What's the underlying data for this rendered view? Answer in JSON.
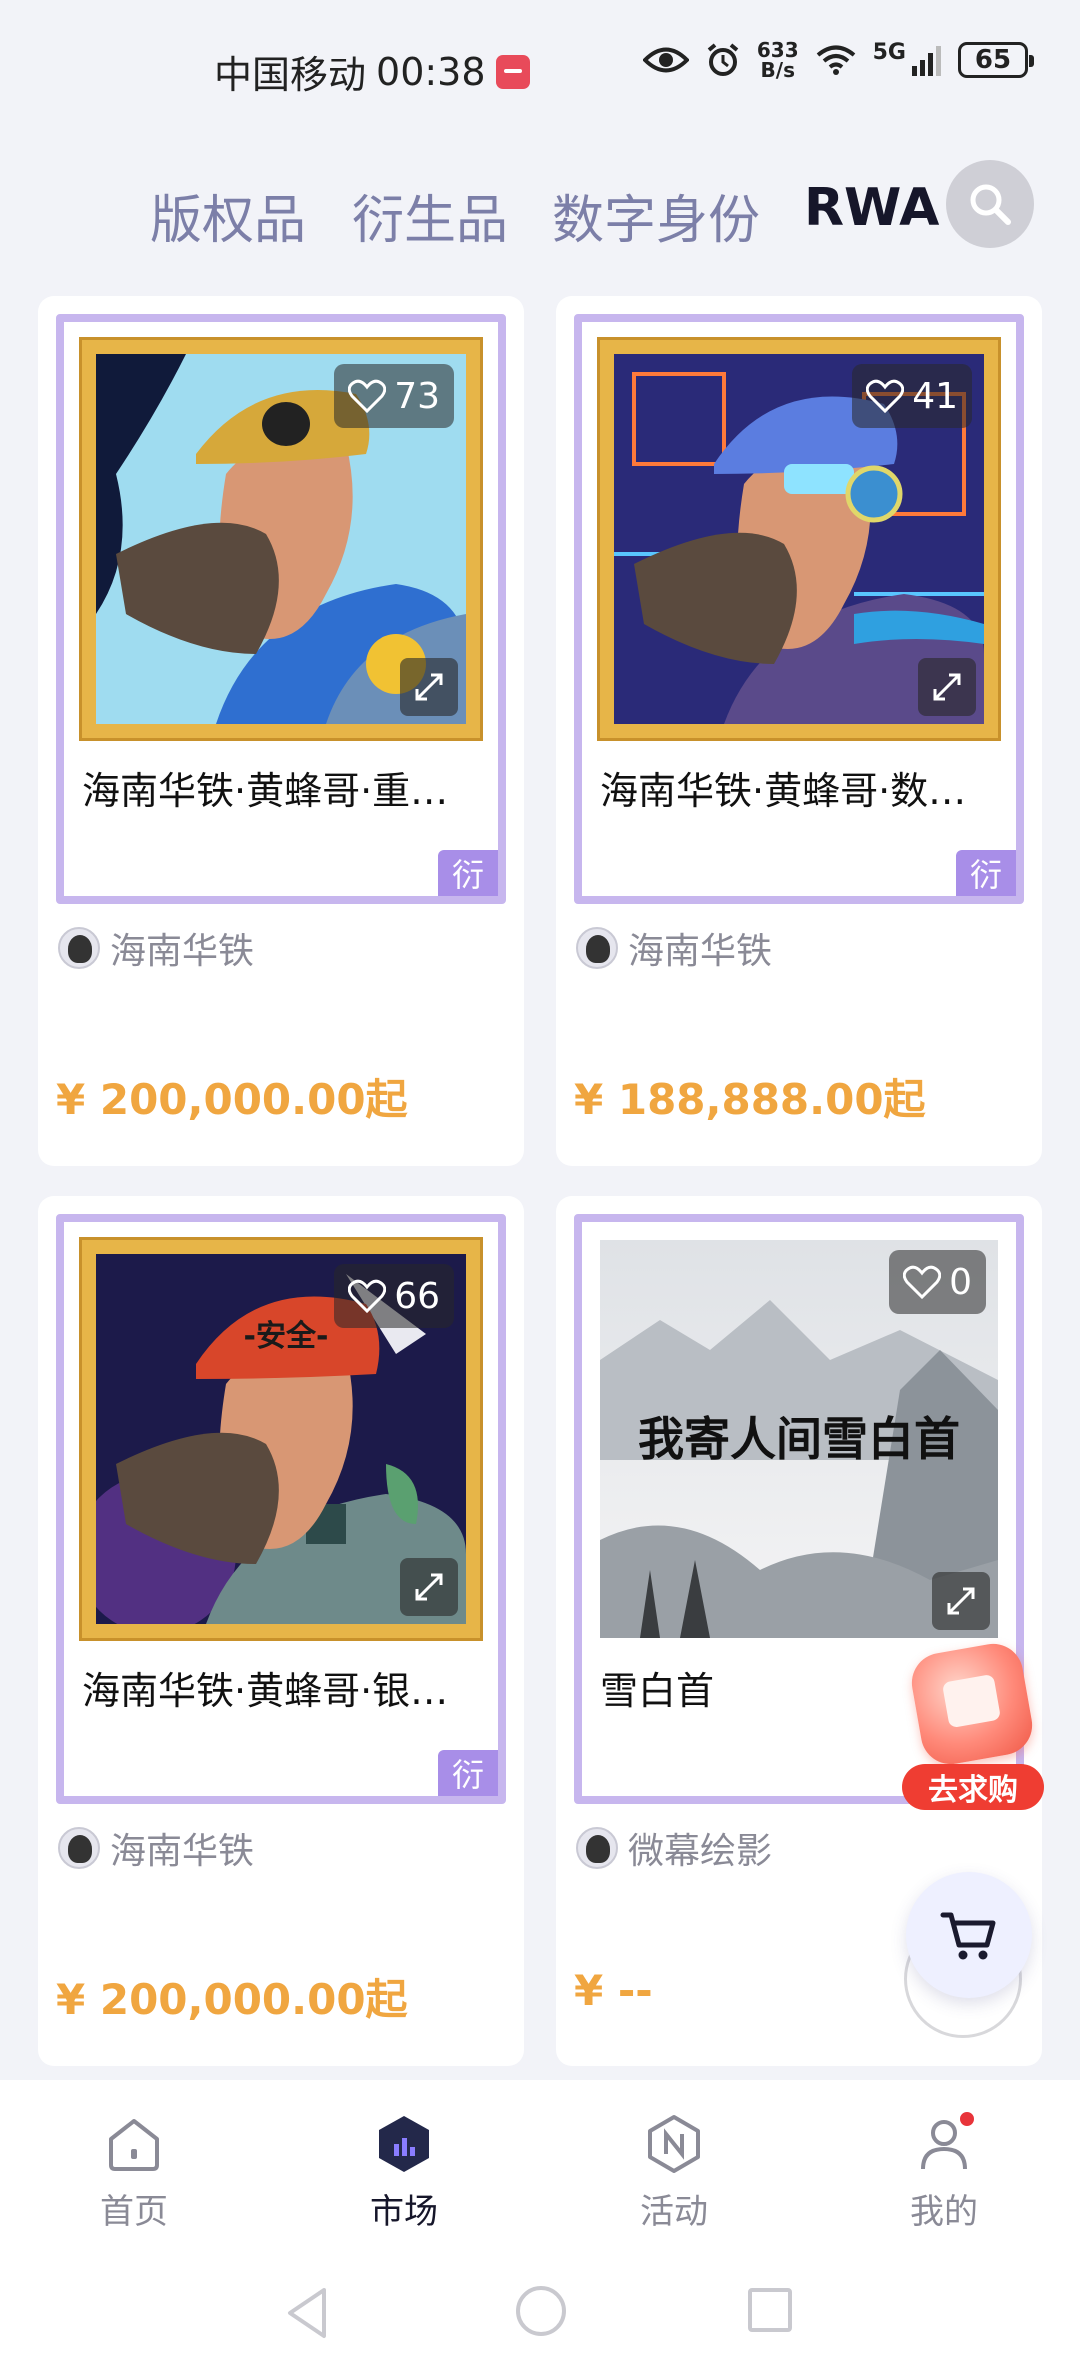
{
  "status_bar": {
    "carrier": "中国移动",
    "time": "00:38",
    "speed_value": "633",
    "speed_unit": "B/s",
    "network": "5G",
    "battery": "65"
  },
  "tabs": [
    {
      "label": "版权品"
    },
    {
      "label": "衍生品"
    },
    {
      "label": "数字身份"
    },
    {
      "label": "RWA"
    }
  ],
  "active_tab": "RWA",
  "cards": [
    {
      "title": "海南华铁·黄蜂哥·重…",
      "likes": "73",
      "tag": "衍",
      "creator": "海南华铁",
      "price": "¥ 200,000.00起",
      "art": "miner-yellow-helmet"
    },
    {
      "title": "海南华铁·黄蜂哥·数…",
      "likes": "41",
      "tag": "衍",
      "creator": "海南华铁",
      "price": "¥ 188,888.00起",
      "art": "cyber-blue-helmet"
    },
    {
      "title": "海南华铁·黄蜂哥·银…",
      "likes": "66",
      "tag": "衍",
      "creator": "海南华铁",
      "price": "¥ 200,000.00起",
      "art": "red-safety-helmet",
      "helmet_text": "-安全-"
    },
    {
      "title": "雪白首",
      "likes": "0",
      "tag": "",
      "creator": "微幕绘影",
      "price": "¥ --",
      "art": "snow-landscape",
      "art_text": "我寄人间雪白首"
    }
  ],
  "float": {
    "qiugou_label": "去求购"
  },
  "bottom_nav": [
    {
      "label": "首页",
      "icon": "home-icon"
    },
    {
      "label": "市场",
      "icon": "market-icon"
    },
    {
      "label": "活动",
      "icon": "activity-icon"
    },
    {
      "label": "我的",
      "icon": "profile-icon"
    }
  ],
  "active_nav": "市场",
  "colors": {
    "accent_purple": "#c7b6ee",
    "price_orange": "#f0a640",
    "tag_purple": "#a88ee8",
    "qiugou_red": "#ef3d32"
  }
}
